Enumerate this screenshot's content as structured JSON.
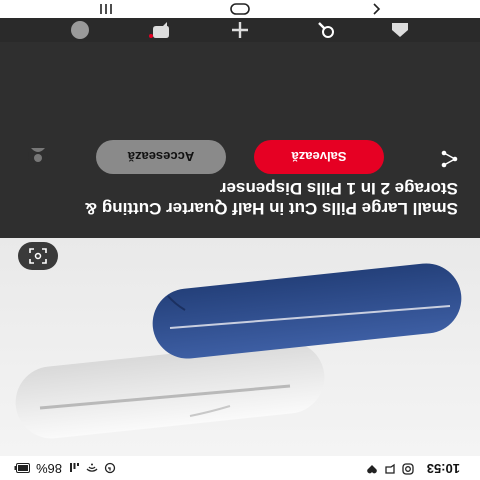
{
  "status_bar": {
    "time": "10:53",
    "battery": "86%",
    "icons": [
      "instagram-icon",
      "chat-icon",
      "heart-icon",
      "wifi-icon",
      "signal-icon",
      "alarm-icon",
      "battery-icon"
    ]
  },
  "photo": {
    "alt_subject": "pill-box-product-image",
    "lens_icon": "visual-search-icon",
    "back_icon": "back-icon",
    "more_icon": "more-icon"
  },
  "pin": {
    "title": "Small Large Pills Cut in Half Quarter Cutting & Storage 2 In 1 Pills Dispenser",
    "save_label": "Salvează",
    "visit_label": "Accesează",
    "share_icon": "share-icon",
    "avatar_icon": "avatar-icon"
  },
  "bottom_nav": {
    "items": [
      {
        "icon": "home-icon"
      },
      {
        "icon": "search-icon"
      },
      {
        "icon": "plus-icon"
      },
      {
        "icon": "notifications-icon"
      },
      {
        "icon": "profile-avatar-icon"
      }
    ]
  },
  "system_nav": {
    "items": [
      {
        "icon": "recent-apps-icon"
      },
      {
        "icon": "home-circle-icon"
      },
      {
        "icon": "back-chevron-icon"
      }
    ]
  },
  "colors": {
    "accent_save": "#e60023",
    "panel_bg": "#2f2f2f",
    "visit_bg": "#8a8a8a",
    "pill_blue": "#2f4f8f",
    "pill_white": "#e6e6e6"
  }
}
